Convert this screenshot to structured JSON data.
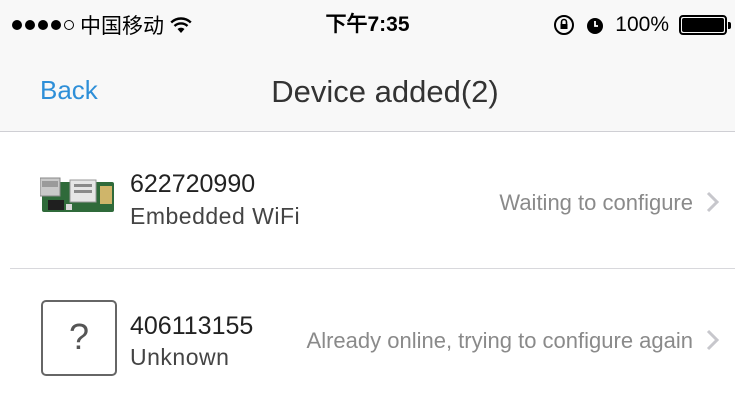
{
  "status_bar": {
    "carrier": "中国移动",
    "time": "下午7:35",
    "battery": "100%",
    "icons": [
      "signal-dots-icon",
      "wifi-icon",
      "rotation-lock-icon",
      "alarm-icon",
      "battery-icon"
    ]
  },
  "nav": {
    "back_label": "Back",
    "title": "Device added(2)"
  },
  "devices": [
    {
      "id": "622720990",
      "type": "Embedded WiFi",
      "status": "Waiting to configure",
      "icon": "wifi-module-board-icon"
    },
    {
      "id": "406113155",
      "type": "Unknown",
      "status": "Already online, trying to configure again",
      "icon": "question-mark-icon",
      "symbol": "?"
    }
  ],
  "colors": {
    "accent": "#2e8fd8",
    "status_text": "#8a8a8a",
    "chevron": "#c7c7cc"
  }
}
